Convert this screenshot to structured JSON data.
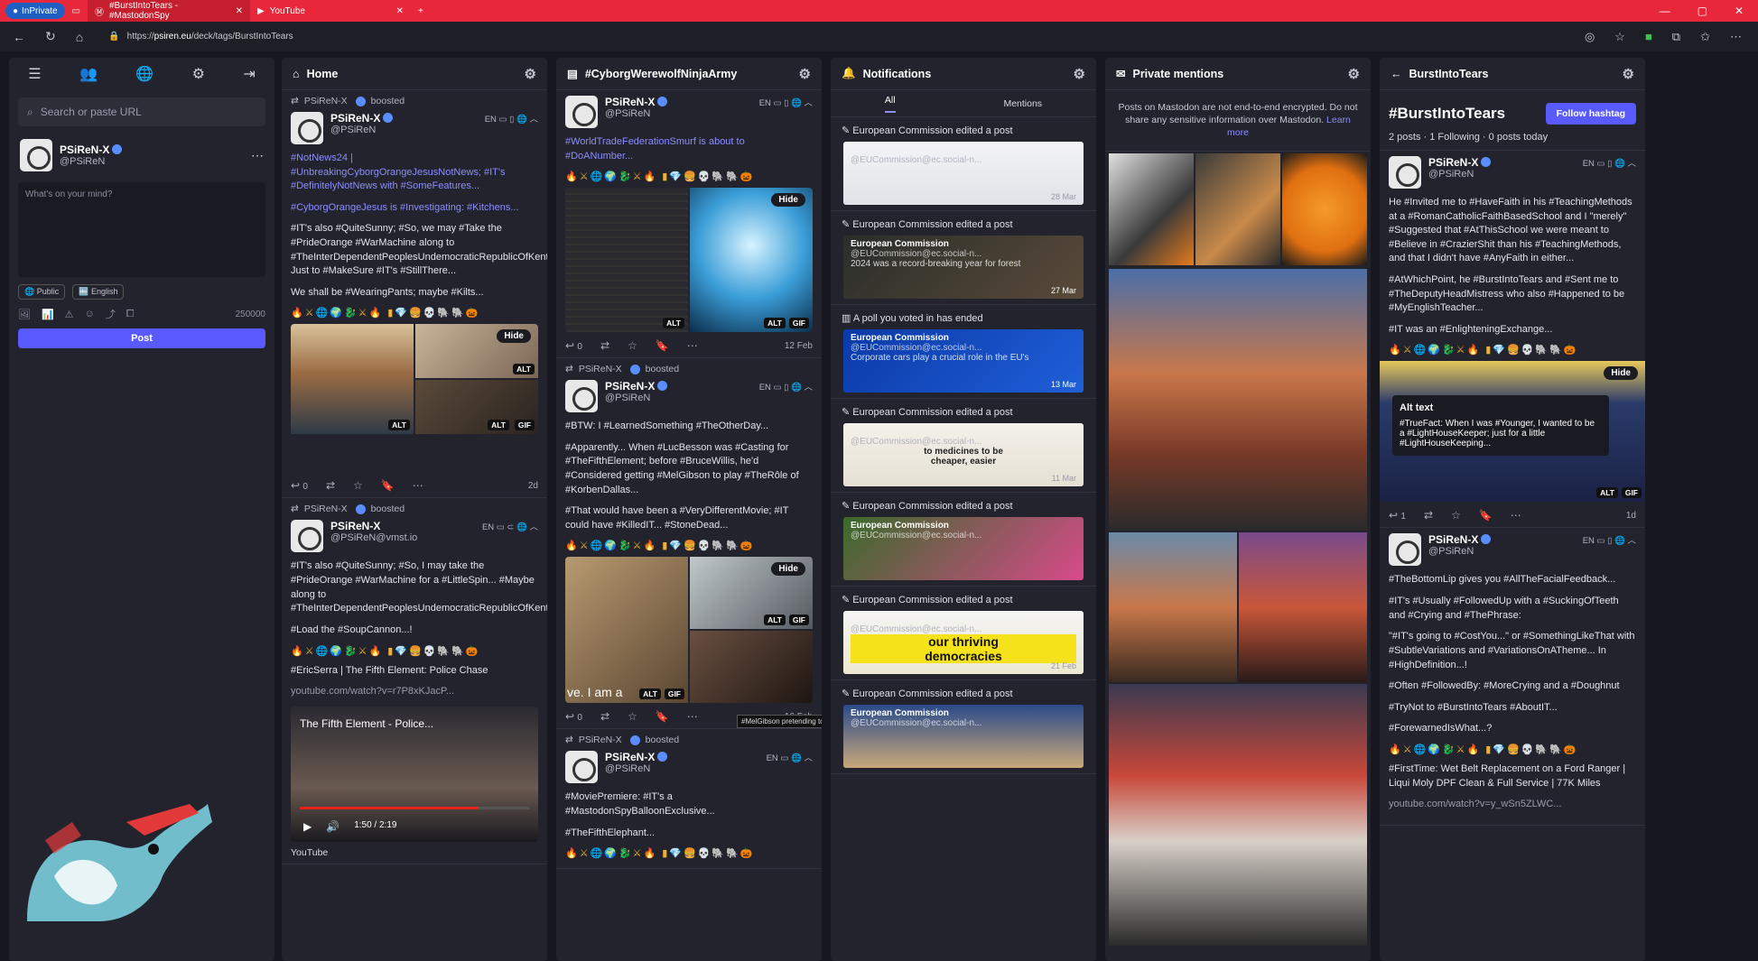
{
  "browser": {
    "inprivate": "InPrivate",
    "tab_active": "#BurstIntoTears - #MastodonSpy",
    "tab_youtube": "YouTube",
    "new_tab": "+",
    "url_prefix": "https://",
    "url_host": "psiren.eu",
    "url_path": "/deck/tags/BurstIntoTears"
  },
  "nav": {
    "search_placeholder": "Search or paste URL"
  },
  "me": {
    "name": "PSiReN-X",
    "handle": "@PSiReN"
  },
  "composer": {
    "placeholder": "What's on your mind?",
    "visibility": "Public",
    "language": "English",
    "char_count": "250000",
    "post_label": "Post"
  },
  "columns": {
    "home": "Home",
    "hashtag_ninja": "#CyborgWerewolfNinjaArmy",
    "notifications": "Notifications",
    "private": "Private mentions",
    "burst": "BurstIntoTears"
  },
  "common": {
    "boosted": "boosted",
    "hide": "Hide",
    "alt": "ALT",
    "gif": "GIF",
    "lang": "EN",
    "name": "PSiReN-X",
    "handle": "@PSiReN"
  },
  "home_posts": [
    {
      "booster": "PSiReN-X",
      "name": "PSiReN-X",
      "handle": "@PSiReN",
      "paragraphs": [
        "#NotNews24 | #UnbreakingCyborgOrangeJesusNotNews; #IT's #DefinitelyNotNews with #SomeFeatures...",
        "#CyborgOrangeJesus is #Investigating: #Kitchens...",
        "#IT's also #QuiteSunny; #So, we may #Take the #PrideOrange #WarMachine along to #TheInterDependentPeoplesUndemocraticRepublicOfKent... Just to #MakeSure #IT's #StillThere...",
        "We shall be #WearingPants; maybe #Kilts..."
      ],
      "reply_count": "0",
      "date": "2d"
    },
    {
      "booster": "PSiReN-X",
      "name": "PSiReN-X",
      "handle": "@PSiReN@vmst.io",
      "paragraphs": [
        "#IT's also #QuiteSunny; #So, I may take the #PrideOrange #WarMachine for a #LittleSpin... #Maybe along to #TheInterDependentPeoplesUndemocraticRepublicOfKent...",
        "#Load the #SoupCannon...!",
        "#EricSerra | The Fifth Element: Police Chase"
      ],
      "link": "youtube.com/watch?v=r7P8xKJacP...",
      "video_title": "The Fifth Element - Police...",
      "video_time": "1:50 / 2:19",
      "video_source": "YouTube"
    }
  ],
  "ninja_posts": [
    {
      "name": "PSiReN-X",
      "handle": "@PSiReN",
      "paragraphs": [
        "#WorldTradeFederationSmurf is about to #DoANumber..."
      ],
      "reply_count": "0",
      "date": "12 Feb"
    },
    {
      "booster": "PSiReN-X",
      "name": "PSiReN-X",
      "handle": "@PSiReN",
      "paragraphs": [
        "#BTW: I #LearnedSomething #TheOtherDay...",
        "#Apparently... When #LucBesson was #Casting for #TheFifthElement; before #BruceWillis, he'd #Considered getting #MelGibson to play #TheRôle of #KorbenDallas...",
        "#That would have been a #VeryDifferentMovie; #IT could have #KilledIT... #StoneDead..."
      ],
      "caption": "ve. I am a",
      "tooltip": "#MelGibson pretending to be #Scottish in #TheWrongMovie...",
      "reply_count": "0",
      "date": "16 Feb"
    },
    {
      "booster": "PSiReN-X",
      "name": "PSiReN-X",
      "handle": "@PSiReN",
      "paragraphs": [
        "#MoviePremiere: #IT's a #MastodonSpyBalloonExclusive...",
        "#TheFifthElephant..."
      ]
    }
  ],
  "notifications": {
    "tab_all": "All",
    "tab_mentions": "Mentions",
    "items": [
      {
        "label": "European Commission edited a post",
        "account": "@EUCommission@ec.social-n...",
        "date": "28 Mar"
      },
      {
        "label": "European Commission edited a post",
        "account": "@EUCommission@ec.social-n...",
        "date": "27 Mar"
      },
      {
        "label": "A poll you voted in has ended",
        "account": "@EUCommission@ec.social-n...",
        "date": "13 Mar"
      },
      {
        "label": "European Commission edited a post",
        "account": "@EUCommission@ec.social-n...",
        "date": "11 Mar"
      },
      {
        "label": "European Commission edited a post",
        "account": "@EUCommission@ec.social-n...",
        "date": ""
      },
      {
        "label": "European Commission edited a post",
        "account": "@EUCommission@ec.social-n...",
        "date": "21 Feb"
      },
      {
        "label": "European Commission edited a post",
        "account": "@EUCommission@ec.social-n...",
        "date": ""
      }
    ],
    "card_name": "European Commission",
    "card2_text": "2024 was a record-breaking year for forest",
    "card3_text": "Corporate cars play a crucial role in the EU's",
    "card4_line1": "to medicines to be",
    "card4_line2": "cheaper, easier",
    "card6_line1": "our thriving",
    "card6_line2": "democracies"
  },
  "private": {
    "warning": "Posts on Mastodon are not end-to-end encrypted. Do not share any sensitive information over Mastodon.",
    "learn_more": "Learn more"
  },
  "burst": {
    "tag": "#BurstIntoTears",
    "follow": "Follow hashtag",
    "stats": "2 posts · 1 Following · 0 posts today",
    "post1": {
      "name": "PSiReN-X",
      "handle": "@PSiReN",
      "paragraphs": [
        "He #Invited me to #HaveFaith in his #TeachingMethods at a #RomanCatholicFaithBasedSchool and I \"merely\" #Suggested that #AtThisSchool we were meant to #Believe in #CrazierShit than his #TeachingMethods, and that I didn't have #AnyFaith in either...",
        "#AtWhichPoint, he #BurstIntoTears and #Sent me to #TheDeputyHeadMistress who also #Happened to be #MyEnglishTeacher...",
        "#IT was an #EnlighteningExchange..."
      ],
      "alt_title": "Alt text",
      "alt_text": "#TrueFact: When I was #Younger, I wanted to be a #LightHouseKeeper; just for a little #LightHouseKeeping...",
      "reply_count": "1",
      "date": "1d"
    },
    "post2": {
      "name": "PSiReN-X",
      "handle": "@PSiReN",
      "paragraphs": [
        "#TheBottomLip gives you #AllTheFacialFeedback...",
        "#IT's #Usually #FollowedUp with a #SuckingOfTeeth and #Crying and #ThePhrase:",
        "\"#IT's going to #CostYou...\" or #SomethingLikeThat with #SubtleVariations and #VariationsOnATheme... In #HighDefinition...!",
        "#Often #FollowedBy: #MoreCrying and a #Doughnut",
        "#TryNot to #BurstIntoTears #AboutIT...",
        "#ForewarnedIsWhat...?",
        "#FirstTime: Wet Belt Replacement on a Ford Ranger | Liqui Moly DPF Clean & Full Service | 77K Miles"
      ],
      "link": "youtube.com/watch?v=y_wSn5ZLWC..."
    }
  },
  "emoji_row": "🔥⚔🌐🌍🐉⚔🔥 ▮💎🍔💀🐘🐘🎃",
  "colors": {
    "accent": "#595aff",
    "hashtag": "#8c8dff",
    "tabbar": "#e8283a",
    "bg": "#17181f",
    "panel": "#22232c"
  }
}
